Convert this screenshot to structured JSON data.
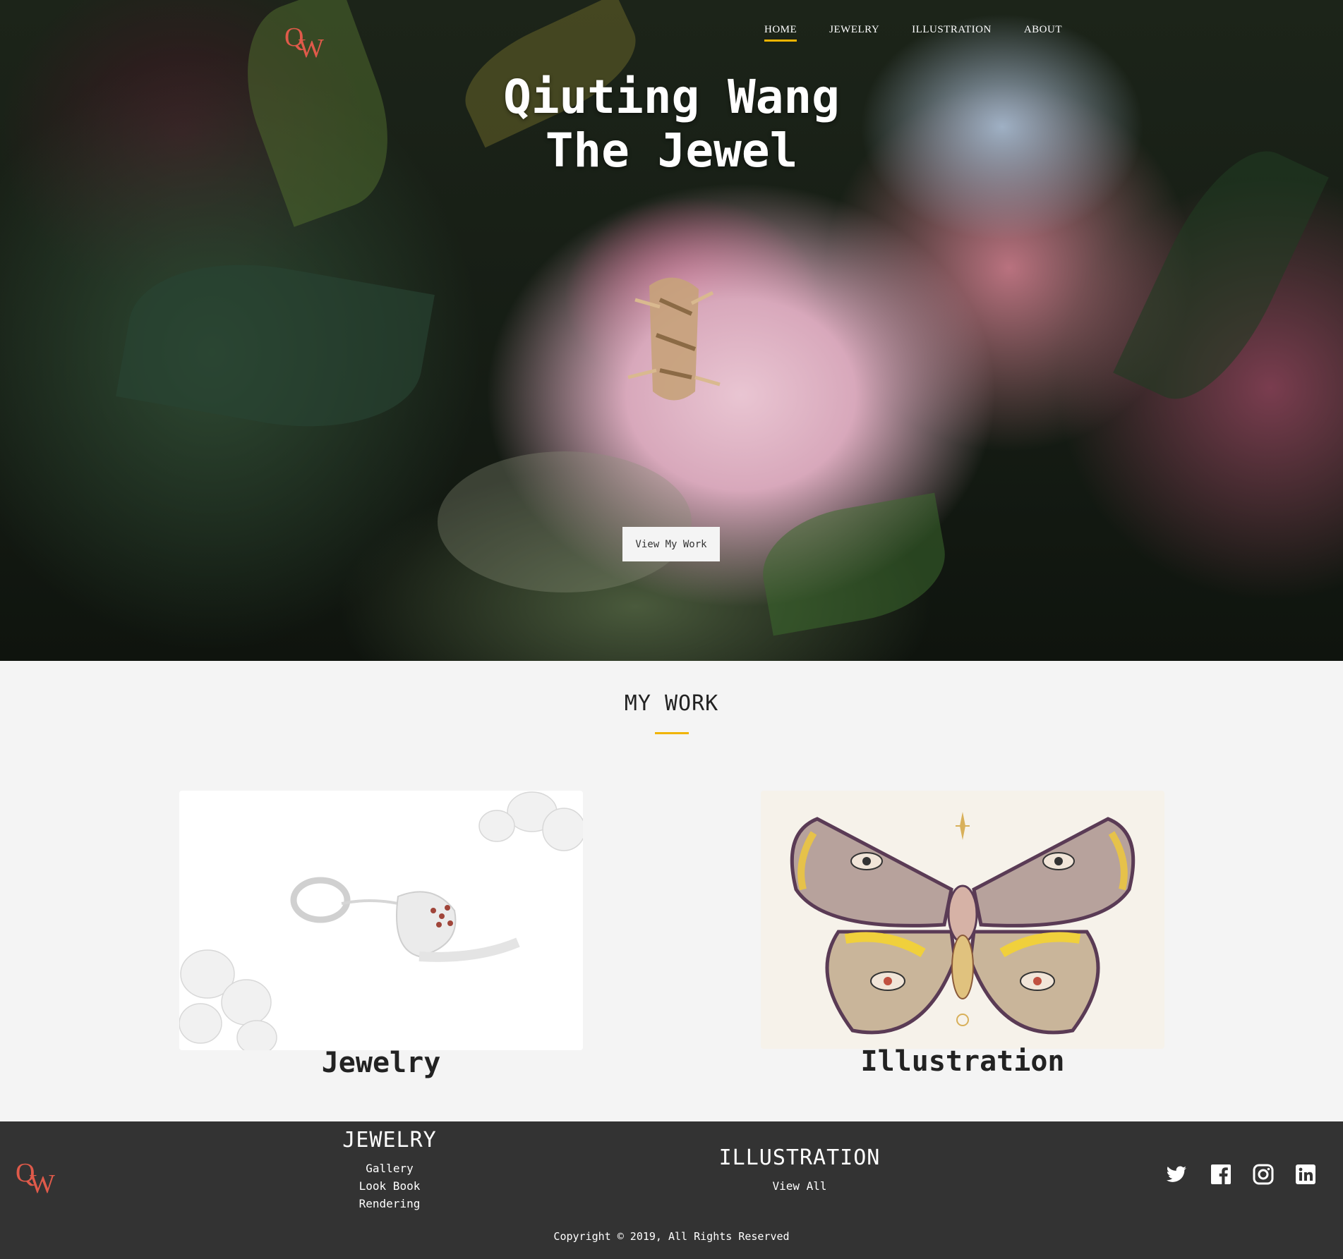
{
  "nav": {
    "logo": {
      "q": "Q",
      "w": "W"
    },
    "items": [
      {
        "label": "HOME",
        "active": true
      },
      {
        "label": "JEWELRY",
        "active": false
      },
      {
        "label": "ILLUSTRATION",
        "active": false
      },
      {
        "label": "ABOUT",
        "active": false
      }
    ],
    "accent": "#f0b400"
  },
  "hero": {
    "title_line1": "Qiuting Wang",
    "title_line2": "The Jewel",
    "cta_label": "View My Work"
  },
  "work": {
    "title": "MY WORK",
    "cards": [
      {
        "label": "Jewelry",
        "image": "jewelry-image"
      },
      {
        "label": "Illustration",
        "image": "moth-illustration-image"
      }
    ]
  },
  "footer": {
    "logo": {
      "q": "Q",
      "w": "W"
    },
    "jewelry": {
      "title": "JEWELRY",
      "links": [
        "Gallery",
        "Look Book",
        "Rendering"
      ]
    },
    "illustration": {
      "title": "ILLUSTRATION",
      "links": [
        "View All"
      ]
    },
    "social": [
      "twitter-icon",
      "facebook-icon",
      "instagram-icon",
      "linkedin-icon"
    ],
    "copyright": "Copyright © 2019, All Rights Reserved",
    "background": "#333333"
  }
}
